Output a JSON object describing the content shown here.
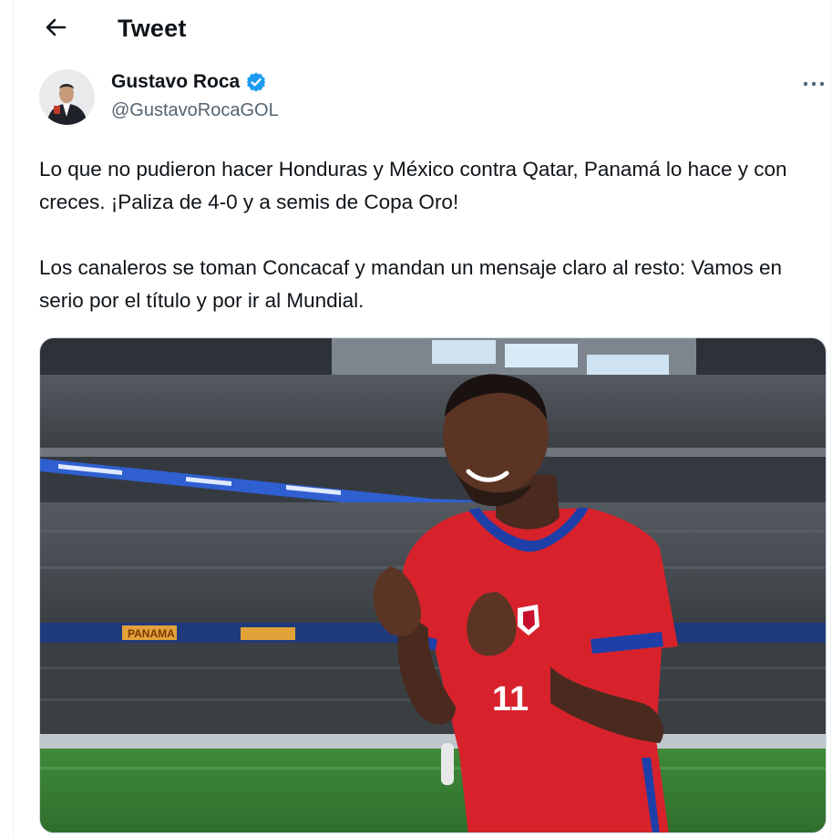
{
  "header": {
    "back_icon": "arrow-left-icon",
    "title": "Tweet"
  },
  "tweet": {
    "author": {
      "display_name": "Gustavo Roca",
      "handle": "@GustavoRocaGOL",
      "verified": true,
      "verified_color": "#1d9bf0"
    },
    "more_icon": "more-horizontal-icon",
    "text_paragraphs": [
      "Lo que no pudieron hacer Honduras y México contra Qatar, Panamá lo hace y con creces. ¡Paliza de 4-0 y a semis de Copa Oro!",
      "Los canaleros se toman Concacaf y mandan un mensaje claro al resto: Vamos en serio por el título y por ir al Mundial."
    ],
    "media": {
      "stadium_banner_text": "PANAMA",
      "jersey_number": "11"
    }
  },
  "colors": {
    "text_primary": "#0f1419",
    "text_secondary": "#536471",
    "accent": "#1d9bf0",
    "jersey_red": "#d8222b",
    "jersey_blue": "#1e3fa8"
  }
}
